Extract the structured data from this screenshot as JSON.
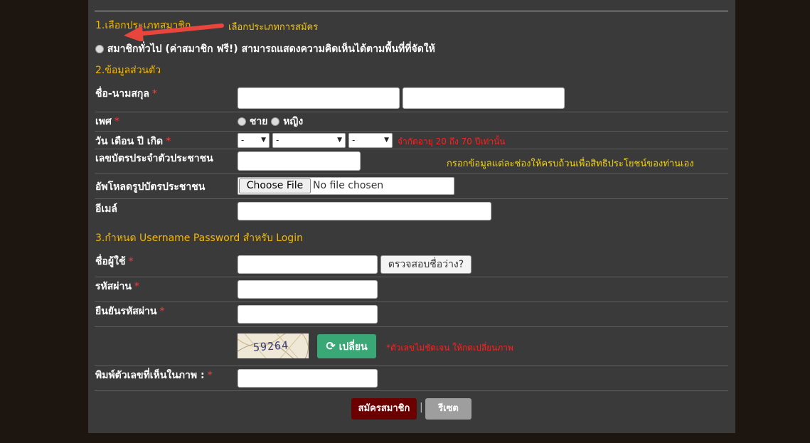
{
  "step1": {
    "title": "1.เลือกประเภทสมาชิก",
    "annotation": "เลือกประเภทการสมัคร",
    "option_general": "สมาชิกทั่วไป (ค่าสมาชิก ฟรี!) สามารถแสดงความคิดเห็นได้ตามพื้นที่ที่จัดให้"
  },
  "step2": {
    "title": "2.ข้อมูลส่วนตัว",
    "name_label": "ชื่อ-นามสกุล",
    "gender_label": "เพศ",
    "gender_male": "ชาย",
    "gender_female": "หญิง",
    "birth_label": "วัน เดือน ปี เกิด",
    "birth_day": "-",
    "birth_month": "-",
    "birth_year": "-",
    "age_note": "จำกัดอายุ 20 ถึง 70 ปีเท่านั้น",
    "id_label": "เลขบัตรประจำตัวประชาชน",
    "fill_note": "กรอกข้อมูลแต่ละช่องให้ครบถ้วนเพื่อสิทธิประโยชน์ของท่านเอง",
    "upload_label": "อัพโหลดรูปบัตรประชาชน",
    "choose_file": "Choose File",
    "no_file": "No file chosen",
    "email_label": "อีเมล์"
  },
  "step3": {
    "title": "3.กำหนด Username Password สำหรับ Login",
    "username_label": "ชื่อผู้ใช้",
    "check_button": "ตรวจสอบชื่อว่าง?",
    "password_label": "รหัสผ่าน",
    "confirm_label": "ยืนยันรหัสผ่าน",
    "captcha_text": "59264",
    "refresh_button": "เปลี่ยน",
    "captcha_note": "*ตัวเลขไม่ชัดเจน ให้กดเปลี่ยนภาพ",
    "captcha_label": "พิมพ์ตัวเลขที่เห็นในภาพ :"
  },
  "required_mark": "*",
  "actions": {
    "submit": "สมัครสมาชิก",
    "separator": "|",
    "reset": "รีเซต"
  },
  "colors": {
    "panel": "#3a3a3a",
    "section_title": "#f5b800",
    "annotation_arrow": "#e8453c",
    "refresh_button": "#3aa876",
    "submit_button": "#6b0000",
    "reset_button": "#9e9e9e"
  }
}
